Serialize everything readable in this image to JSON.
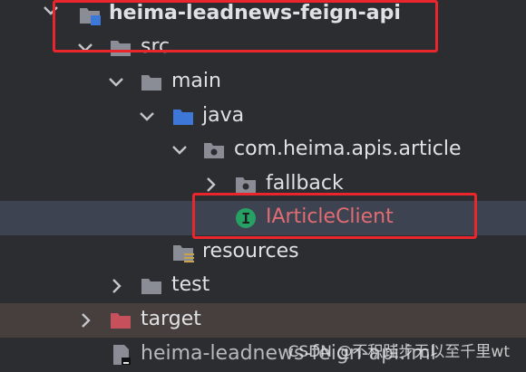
{
  "tree": {
    "module": "heima-leadnews-feign-api",
    "src": "src",
    "main": "main",
    "java": "java",
    "package": "com.heima.apis.article",
    "fallback": "fallback",
    "class": "IArticleClient",
    "resources": "resources",
    "test": "test",
    "target": "target",
    "iml": "heima-leadnews-feign-api.iml"
  },
  "watermark": "CSDN @不积跬步无以至千里wt",
  "colors": {
    "background": "#2b2d30",
    "selection": "#3d4350",
    "excluded": "#463f3d",
    "highlight_border": "#e8262b",
    "folder": "#8b8d96",
    "source_folder": "#3d77d8",
    "excluded_folder": "#c7505d",
    "interface_icon": "#27a163"
  }
}
